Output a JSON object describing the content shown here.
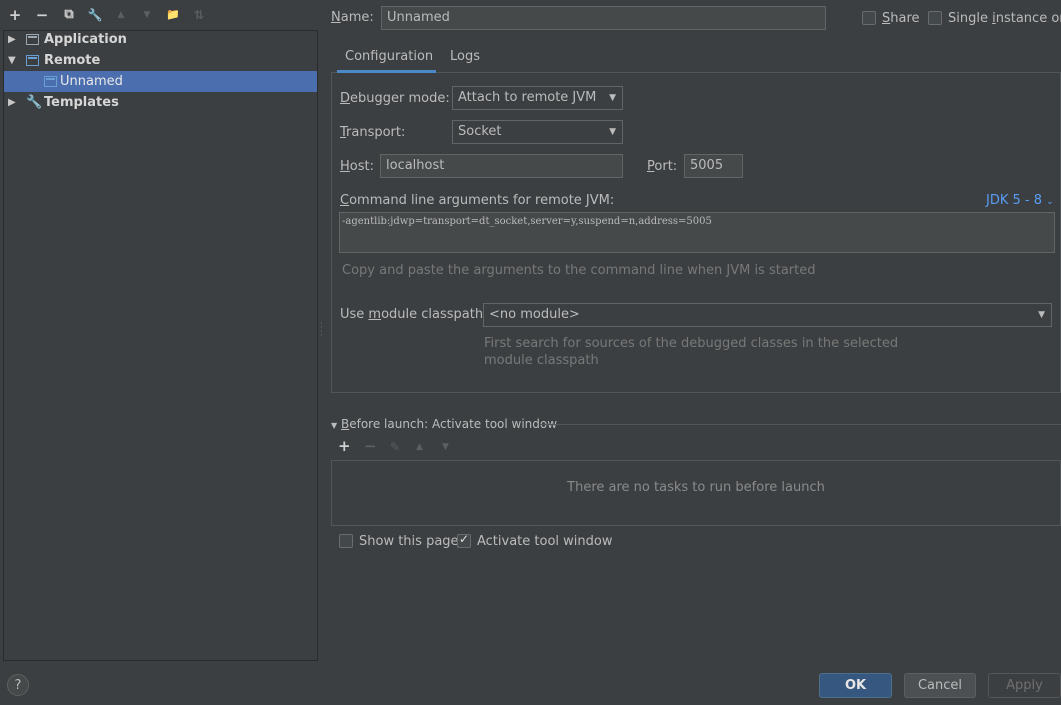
{
  "toolbar": {
    "add": "+",
    "remove": "−",
    "copy": "⧉",
    "edit": "🔧",
    "up": "▲",
    "down": "▼",
    "folder": "📁",
    "sort": "⇅"
  },
  "tree": {
    "application": "Application",
    "remote": "Remote",
    "unnamed": "Unnamed",
    "templates": "Templates"
  },
  "header": {
    "name_label_prefix": "N",
    "name_label_rest": "ame:",
    "name_value": "Unnamed",
    "share_label_prefix": "S",
    "share_label_rest": "hare",
    "single_instance_before": "Single ",
    "single_instance_ul": "i",
    "single_instance_after": "nstance only"
  },
  "tabs": [
    "Configuration",
    "Logs"
  ],
  "config": {
    "debugger_mode_ul": "D",
    "debugger_mode_rest": "ebugger mode:",
    "debugger_mode_value": "Attach to remote JVM",
    "transport_ul": "T",
    "transport_rest": "ransport:",
    "transport_value": "Socket",
    "host_ul": "H",
    "host_rest": "ost:",
    "host_value": "localhost",
    "port_ul": "P",
    "port_rest": "ort:",
    "port_value": "5005",
    "cmd_label_ul": "C",
    "cmd_label_rest": "ommand line arguments for remote JVM:",
    "jdk_link": "JDK 5 - 8",
    "cmd_value": "-agentlib:jdwp=transport=dt_socket,server=y,suspend=n,address=5005",
    "cmd_hint": "Copy and paste the arguments to the command line when JVM is started",
    "module_label_before": "Use ",
    "module_label_ul": "m",
    "module_label_after": "odule classpath:",
    "module_value": "<no module>",
    "module_hint_1": "First search for sources of the debugged classes in the selected",
    "module_hint_2": "module classpath"
  },
  "before_launch": {
    "title_ul": "B",
    "title_rest": "efore launch: Activate tool window",
    "empty": "There are no tasks to run before launch",
    "show_page": "Show this page",
    "activate_tool": "Activate tool window"
  },
  "footer": {
    "help": "?",
    "ok": "OK",
    "cancel": "Cancel",
    "apply": "Apply"
  }
}
